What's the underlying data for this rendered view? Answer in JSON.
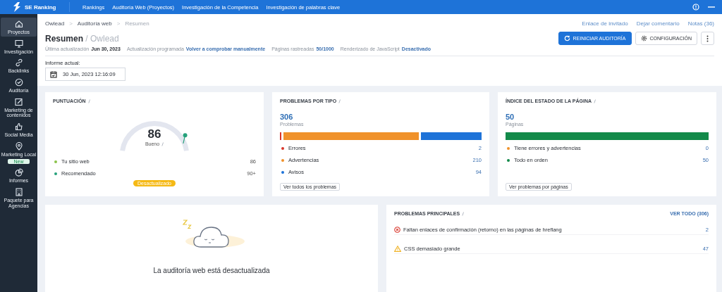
{
  "topbar": {
    "brand": "SE Ranking",
    "nav": [
      {
        "label": "Rankings"
      },
      {
        "label": "Auditoría Web (Proyectos)"
      },
      {
        "label": "Investigación de la Competencia"
      },
      {
        "label": "Investigación de palabras clave"
      }
    ]
  },
  "sidebar": {
    "items": [
      {
        "label": "Proyectos",
        "kind": "home",
        "selected": true
      },
      {
        "label": "Investigación",
        "kind": "monitor",
        "selected": false
      },
      {
        "label": "Backlinks",
        "kind": "link",
        "selected": false
      },
      {
        "label": "Auditoría",
        "kind": "check",
        "selected": false
      },
      {
        "label": "Marketing de contenidos",
        "kind": "edit",
        "selected": false
      },
      {
        "label": "Social Media",
        "kind": "thumb",
        "selected": false
      },
      {
        "label": "Marketing Local",
        "kind": "pin",
        "selected": false,
        "badge": "New"
      },
      {
        "label": "Informes",
        "kind": "chart",
        "selected": false
      },
      {
        "label": "Paquete para Agencias",
        "kind": "building",
        "selected": false
      }
    ]
  },
  "breadcrumbs": [
    "Owlead",
    "Auditoría web",
    "Resumen"
  ],
  "breadcrumb_separator": ">",
  "header_links": [
    "Enlace de invitado",
    "Dejar comentario",
    "Notas (36)"
  ],
  "title": "Resumen",
  "title_separator": "/",
  "subtitle": "Owlead",
  "buttons": {
    "restart": "REINICIAR AUDITORÍA",
    "settings": "CONFIGURACIÓN"
  },
  "meta": [
    {
      "label": "Última actualización",
      "value": "Jun 30, 2023",
      "kind": "plain"
    },
    {
      "label": "Actualización programada",
      "value": "Volver a comprobar manualmente",
      "kind": "link"
    },
    {
      "label": "Páginas rastreadas",
      "value": "50/1000",
      "kind": "link"
    },
    {
      "label": "Renderizado de JavaScript",
      "value": "Desactivado",
      "kind": "link"
    }
  ],
  "report": {
    "label": "Informe actual:",
    "value": "30 Jun, 2023 12:16:09"
  },
  "score": {
    "title": "PUNTUACIÓN",
    "value": "86",
    "level": 0.86,
    "rating": "Bueno",
    "rows": [
      {
        "label": "Tu sitio web",
        "value": "86",
        "color": "#8bc34a"
      },
      {
        "label": "Recomendado",
        "value": "90+",
        "color": "#26a17b"
      }
    ],
    "badge": "Desactualizado"
  },
  "issues": {
    "title": "PROBLEMAS POR TIPO",
    "total": "306",
    "unit": "Problemas",
    "rows": [
      {
        "label": "Errores",
        "count": "2",
        "color": "#d9362b"
      },
      {
        "label": "Advertencias",
        "count": "210",
        "color": "#f0922b"
      },
      {
        "label": "Avisos",
        "count": "94",
        "color": "#1e73d8"
      }
    ],
    "button": "Ver todos los problemas"
  },
  "health": {
    "title": "ÍNDICE DEL ESTADO DE LA PÁGINA",
    "total": "50",
    "unit": "Páginas",
    "rows": [
      {
        "label": "Tiene errores y advertencias",
        "count": "0",
        "color": "#f0922b"
      },
      {
        "label": "Todo en orden",
        "count": "50",
        "color": "#138a4a"
      }
    ],
    "button": "Ver problemas por páginas"
  },
  "outdated": {
    "message": "La auditoría web está desactualizada"
  },
  "top_issues": {
    "title": "PROBLEMAS PRINCIPALES",
    "link": "VER TODO (306)",
    "rows": [
      {
        "label": "Faltan enlaces de confirmación (retorno) en las páginas de hreflang",
        "count": "2",
        "kind": "error"
      },
      {
        "label": "CSS demasiado grande",
        "count": "47",
        "kind": "warning"
      }
    ]
  }
}
